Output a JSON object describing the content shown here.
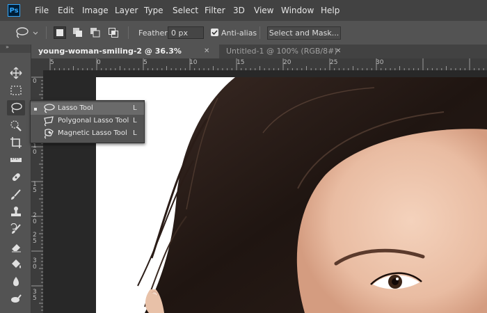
{
  "app": {
    "logo_text": "Ps",
    "menu": [
      "File",
      "Edit",
      "Image",
      "Layer",
      "Type",
      "Select",
      "Filter",
      "3D",
      "View",
      "Window",
      "Help"
    ]
  },
  "options": {
    "feather_label": "Feather:",
    "feather_value": "0 px",
    "antialias_label": "Anti-alias",
    "antialias_checked": true,
    "select_mask_label": "Select and Mask..."
  },
  "tabs": [
    {
      "label": "young-woman-smiling-2 @ 36.3% (RGB/8*) *",
      "active": true,
      "close": "✕"
    },
    {
      "label": "Untitled-1 @ 100% (RGB/8#)",
      "active": false,
      "close": "✕"
    }
  ],
  "hruler": {
    "labels": [
      "5",
      "0",
      "5",
      "10",
      "15",
      "20",
      "25",
      "30"
    ]
  },
  "vruler": {
    "labels": [
      "0",
      "5",
      "1 0",
      "1 5",
      "2 0",
      "2 5",
      "3 0",
      "3 5"
    ]
  },
  "toolbar": {
    "collapse_glyph": "»",
    "tools": [
      "move-icon",
      "marquee-icon",
      "lasso-icon",
      "quick-select-icon",
      "crop-icon",
      "ruler-icon",
      "healing-icon",
      "brush-icon",
      "stamp-icon",
      "history-brush-icon",
      "eraser-icon",
      "paint-bucket-icon",
      "blur-icon",
      "smudge-icon"
    ]
  },
  "flyout": {
    "items": [
      {
        "label": "Lasso Tool",
        "key": "L",
        "selected": true,
        "icon": "lasso-icon"
      },
      {
        "label": "Polygonal Lasso Tool",
        "key": "L",
        "selected": false,
        "icon": "polygonal-lasso-icon"
      },
      {
        "label": "Magnetic Lasso Tool",
        "key": "L",
        "selected": false,
        "icon": "magnetic-lasso-icon"
      }
    ]
  },
  "colors": {
    "menubar": "#424242",
    "panel": "#535353",
    "ruler": "#3c3c3c",
    "pasteboard": "#282828",
    "accent": "#31a8ff"
  }
}
